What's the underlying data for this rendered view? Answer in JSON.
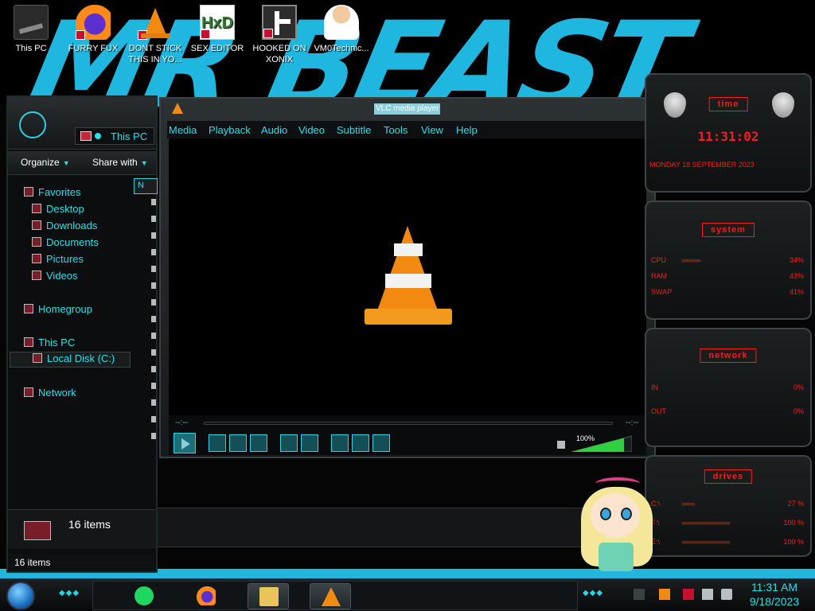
{
  "desktop": {
    "icons": [
      {
        "label": "This PC"
      },
      {
        "label": "FURRY FUX"
      },
      {
        "label": "DONT STICK THIS IN YO..."
      },
      {
        "label": "SEX EDITOR"
      },
      {
        "label": "HOOKED ON XONIX"
      },
      {
        "label": "VM0Technic..."
      }
    ],
    "wallpaper_text": "MR BEAST"
  },
  "explorer": {
    "address": "This PC",
    "toolbar": {
      "organize": "Organize",
      "share_with": "Share with"
    },
    "column_header": "N",
    "nav": {
      "favorites": "Favorites",
      "desktop": "Desktop",
      "downloads": "Downloads",
      "documents": "Documents",
      "pictures": "Pictures",
      "videos": "Videos",
      "homegroup": "Homegroup",
      "this_pc": "This PC",
      "local_disk": "Local Disk (C:)",
      "network": "Network"
    },
    "status_count": "16 items",
    "footer_count": "16 items"
  },
  "vlc": {
    "title": "VLC media player",
    "menu": [
      "Media",
      "Playback",
      "Audio",
      "Video",
      "Subtitle",
      "Tools",
      "View",
      "Help"
    ],
    "time_elapsed": "--:--",
    "time_remaining": "--:--",
    "volume_label": "100%",
    "volume_level": 1.0
  },
  "gadgets": {
    "clock": {
      "title": "time",
      "time": "11:31:02",
      "date": "MONDAY 18 SEPTEMBER 2023"
    },
    "system": {
      "title": "system",
      "rows": [
        {
          "label": "CPU",
          "value": "34%"
        },
        {
          "label": "RAM",
          "value": "43%"
        },
        {
          "label": "SWAP",
          "value": "41%"
        }
      ]
    },
    "network": {
      "title": "network",
      "rows": [
        {
          "label": "IN",
          "value": "0%"
        },
        {
          "label": "OUT",
          "value": "0%"
        }
      ]
    },
    "drives": {
      "title": "drives",
      "rows": [
        {
          "label": "C:\\",
          "value": "27 %"
        },
        {
          "label": "F:\\",
          "value": "100 %"
        },
        {
          "label": "E:\\",
          "value": "100 %"
        }
      ]
    }
  },
  "taskbar": {
    "time": "11:31 AM",
    "date": "9/18/2023",
    "apps": [
      "spotify-icon",
      "firefox-icon",
      "file-explorer-icon",
      "vlc-icon"
    ]
  },
  "colors": {
    "accent": "#27e0ea",
    "alert": "#ff1a1a",
    "vlc_orange": "#f28a12"
  }
}
